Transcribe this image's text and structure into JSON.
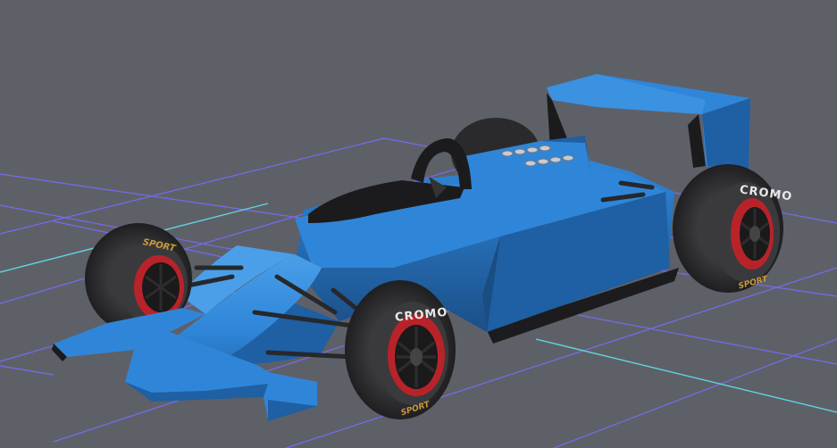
{
  "viewport": {
    "background": "#5e6068",
    "grid_color": "#7a6cff",
    "axis_color": "#5fd6e0"
  },
  "car": {
    "body_color": "#2f86d9",
    "body_shadow": "#1f5fa3",
    "body_highlight": "#4a9fe8",
    "tire_color": "#2c2c2e",
    "rim_color": "#b8232a",
    "dark_color": "#1a1a1a"
  },
  "tires": {
    "brand": "CROMO",
    "sidewall": "SPORT"
  }
}
